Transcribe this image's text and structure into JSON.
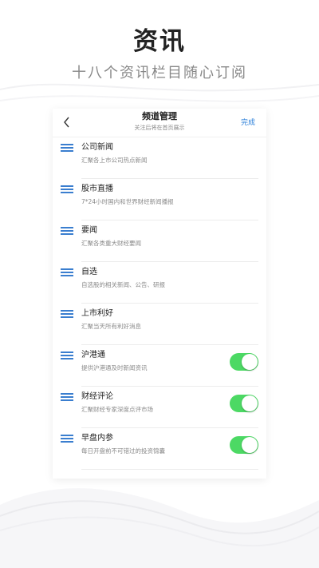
{
  "hero": {
    "title": "资讯",
    "subtitle": "十八个资讯栏目随心订阅"
  },
  "nav": {
    "title": "频道管理",
    "subtitle": "关注后将在首页展示",
    "done_label": "完成",
    "back_icon": "chevron-left-icon"
  },
  "colors": {
    "accent": "#2b7fd9",
    "toggle_on": "#4cd964",
    "drag_handle": "#3a7ecf"
  },
  "channels": [
    {
      "name": "公司新闻",
      "desc": "汇聚各上市公司热点新闻",
      "has_toggle": false
    },
    {
      "name": "股市直播",
      "desc": "7*24小时国内和世界财经新闻播报",
      "has_toggle": false
    },
    {
      "name": "要闻",
      "desc": "汇聚各类重大财经要闻",
      "has_toggle": false
    },
    {
      "name": "自选",
      "desc": "自选股的相关新闻、公告、研报",
      "has_toggle": false
    },
    {
      "name": "上市利好",
      "desc": "汇聚当天所有利好消息",
      "has_toggle": false
    },
    {
      "name": "沪港通",
      "desc": "提供沪港通及时新闻资讯",
      "has_toggle": true,
      "toggle_on": true
    },
    {
      "name": "财经评论",
      "desc": "汇聚财经专家深度点评市场",
      "has_toggle": true,
      "toggle_on": true
    },
    {
      "name": "早盘内参",
      "desc": "每日开盘前不可错过的投资锦囊",
      "has_toggle": true,
      "toggle_on": true
    }
  ]
}
